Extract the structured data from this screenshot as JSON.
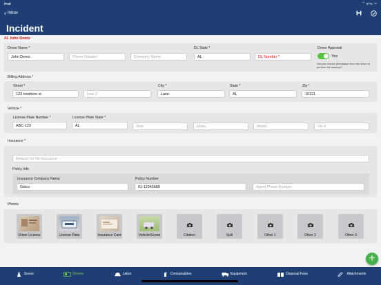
{
  "status": {
    "time": "iPad",
    "carrier": "",
    "battery": "67%"
  },
  "nav": {
    "back_label": "Inbox",
    "title": "Incident"
  },
  "subtitle": "#1 John Demo",
  "driver": {
    "name_label": "Driver Name *",
    "name_value": "John Demo",
    "phone_placeholder": "Phone Number",
    "company_placeholder": "Company Name",
    "dl_state_label": "DL State *",
    "dl_state_value": "AL",
    "dl_number_placeholder": "DL Number *",
    "approval_label": "Driver Approval",
    "approval_value": "Yes",
    "approval_note": "Did you receive permission from the driver to perform the cleanup?"
  },
  "billing": {
    "label": "Billing Address *",
    "street_label": "Street *",
    "street_value": "123 nowhere st",
    "line2_placeholder": "Line 2",
    "city_label": "City *",
    "city_value": "Lane",
    "state_label": "State *",
    "state_value": "AL",
    "zip_label": "Zip *",
    "zip_value": "10121"
  },
  "vehicle": {
    "label": "Vehicle *",
    "plate_label": "License Plate Number *",
    "plate_value": "ABC-123",
    "plate_state_label": "License Plate State *",
    "plate_state_value": "AL",
    "year_placeholder": "Year",
    "make_placeholder": "Make",
    "model_placeholder": "Model",
    "vin_placeholder": "Vin #"
  },
  "insurance": {
    "label": "Insurance *",
    "reason_placeholder": "Reason for No Insurance",
    "policy_info_label": "Policy Info",
    "company_label": "Insurance Company Name",
    "company_value": "Geico",
    "policy_label": "Policy Number",
    "policy_value": "01-12345689",
    "agent_phone_placeholder": "Agent Phone Number"
  },
  "photos": {
    "label": "Photos",
    "items": [
      {
        "label": "Driver License",
        "icon": "license-thumbnail"
      },
      {
        "label": "License Plate",
        "icon": "plate-thumbnail"
      },
      {
        "label": "Insurance Card",
        "icon": "card-thumbnail"
      },
      {
        "label": "Vehicle/Scene",
        "icon": "scene-thumbnail"
      },
      {
        "label": "Citation",
        "icon": "camera-icon"
      },
      {
        "label": "Spill",
        "icon": "camera-icon"
      },
      {
        "label": "Other 1",
        "icon": "camera-icon"
      },
      {
        "label": "Other 2",
        "icon": "camera-icon"
      },
      {
        "label": "Other 3",
        "icon": "camera-icon"
      }
    ]
  },
  "tabs": [
    {
      "label": "Scene",
      "icon": "road-icon"
    },
    {
      "label": "Drivers",
      "icon": "license-card-icon",
      "active": true
    },
    {
      "label": "Labor",
      "icon": "hard-hat-icon"
    },
    {
      "label": "Consumables",
      "icon": "spray-icon"
    },
    {
      "label": "Equipment",
      "icon": "truck-icon"
    },
    {
      "label": "Disposal Fees",
      "icon": "barrels-icon"
    },
    {
      "label": "Attachments",
      "icon": "paperclip-icon"
    }
  ],
  "colors": {
    "nav": "#1f3f74",
    "accent_green": "#46b14a",
    "active_tab": "#6ed14d",
    "required": "#cc1111"
  }
}
